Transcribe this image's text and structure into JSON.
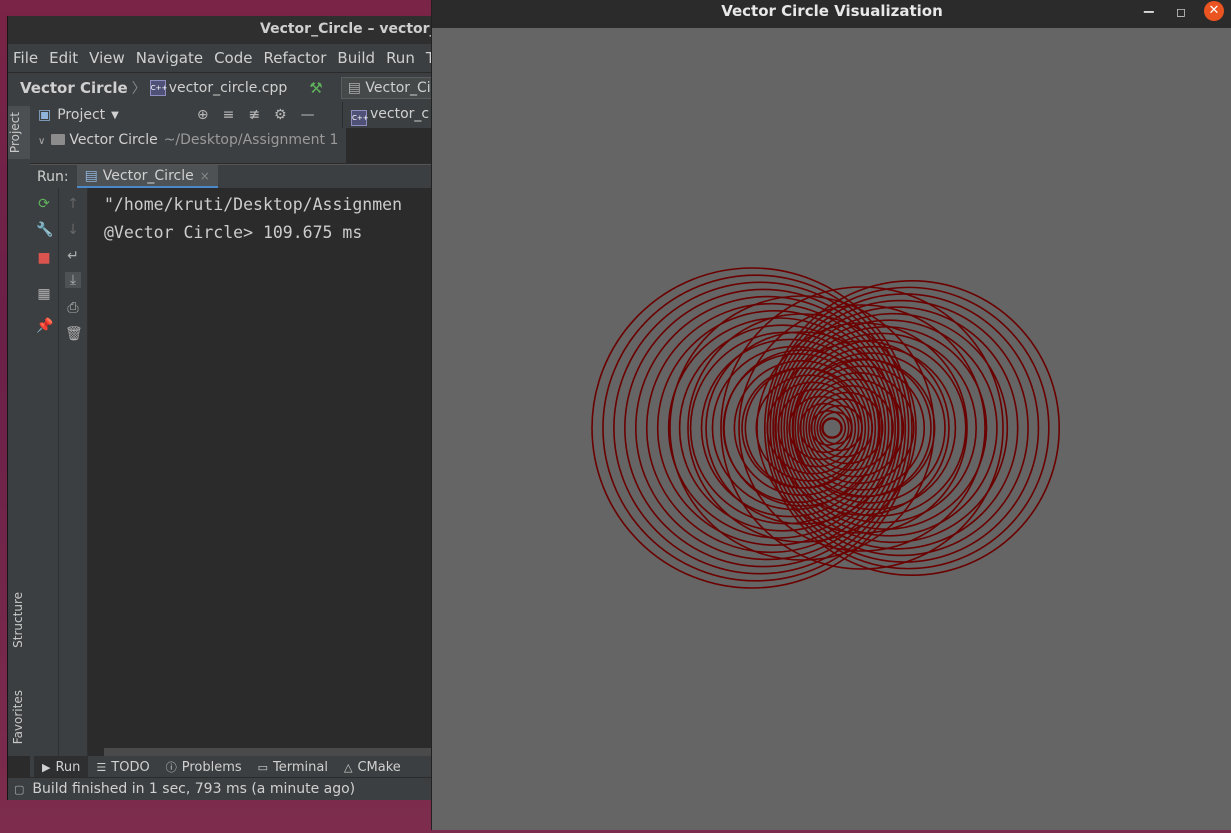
{
  "ide": {
    "window_title": "Vector_Circle – vector_ci",
    "menu": [
      "File",
      "Edit",
      "View",
      "Navigate",
      "Code",
      "Refactor",
      "Build",
      "Run",
      "To"
    ],
    "breadcrumb": {
      "project": "Vector Circle",
      "file": "vector_circle.cpp"
    },
    "run_config": "Vector_Circle",
    "project_panel": {
      "title": "Project",
      "root_name": "Vector Circle",
      "root_path": "~/Desktop/Assignment 1"
    },
    "editor_tab": "vector_c",
    "side_tabs": {
      "project": "Project",
      "structure": "Structure",
      "favorites": "Favorites"
    },
    "run_panel": {
      "label": "Run:",
      "tab": "Vector_Circle",
      "console_lines": [
        "\"/home/kruti/Desktop/Assignmen",
        "@Vector Circle> 109.675 ms"
      ]
    },
    "bottom_tabs": [
      "Run",
      "TODO",
      "Problems",
      "Terminal",
      "CMake"
    ],
    "status": "Build finished in 1 sec, 793 ms (a minute ago)"
  },
  "viz": {
    "title": "Vector Circle Visualization",
    "circle_color": "#6b0000",
    "background": "#656565"
  },
  "icons": {
    "run": "play-icon",
    "stop": "stop-icon",
    "rerun": "rerun-icon",
    "close": "close-icon"
  }
}
